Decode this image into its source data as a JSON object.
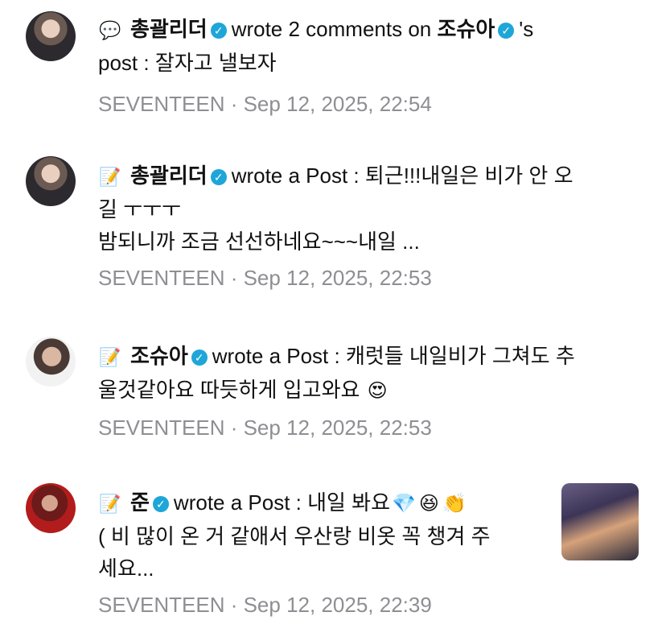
{
  "feed": {
    "items": [
      {
        "type_icon": "💬",
        "user": "총괄리더",
        "action_text": "wrote 2 comments on",
        "target_user": "조슈아",
        "tail": "'s",
        "line2": "post : 잘자고 낼보자",
        "meta": "SEVENTEEN · Sep 12, 2025, 22:54"
      },
      {
        "type_icon": "📝",
        "user": "총괄리더",
        "line1_text": "wrote a Post : 퇴근!!!내일은 비가 안 오",
        "line2": "길 ㅜㅜㅜ",
        "line3": "밤되니까 조금 선선하네요~~~내일 ...",
        "meta": "SEVENTEEN · Sep 12, 2025, 22:53"
      },
      {
        "type_icon": "📝",
        "user": "조슈아",
        "line1_text": "wrote a Post : 캐럿들 내일비가 그쳐도 추",
        "line2": "울것같아요 따듯하게 입고와요",
        "emoji": "😍",
        "meta": "SEVENTEEN · Sep 12, 2025, 22:53"
      },
      {
        "type_icon": "📝",
        "user": "준",
        "line1_text": "wrote a Post : 내일 봐요",
        "emojis": [
          "💎",
          "😆",
          "👏"
        ],
        "line2": "( 비 많이 온 거 같애서 우산랑 비옷 꼭 챙겨 주",
        "line3": "세요...",
        "meta": "SEVENTEEN · Sep 12, 2025, 22:39"
      }
    ]
  },
  "colors": {
    "verified": "#1ea6d8",
    "meta_text": "#8e8e93"
  }
}
